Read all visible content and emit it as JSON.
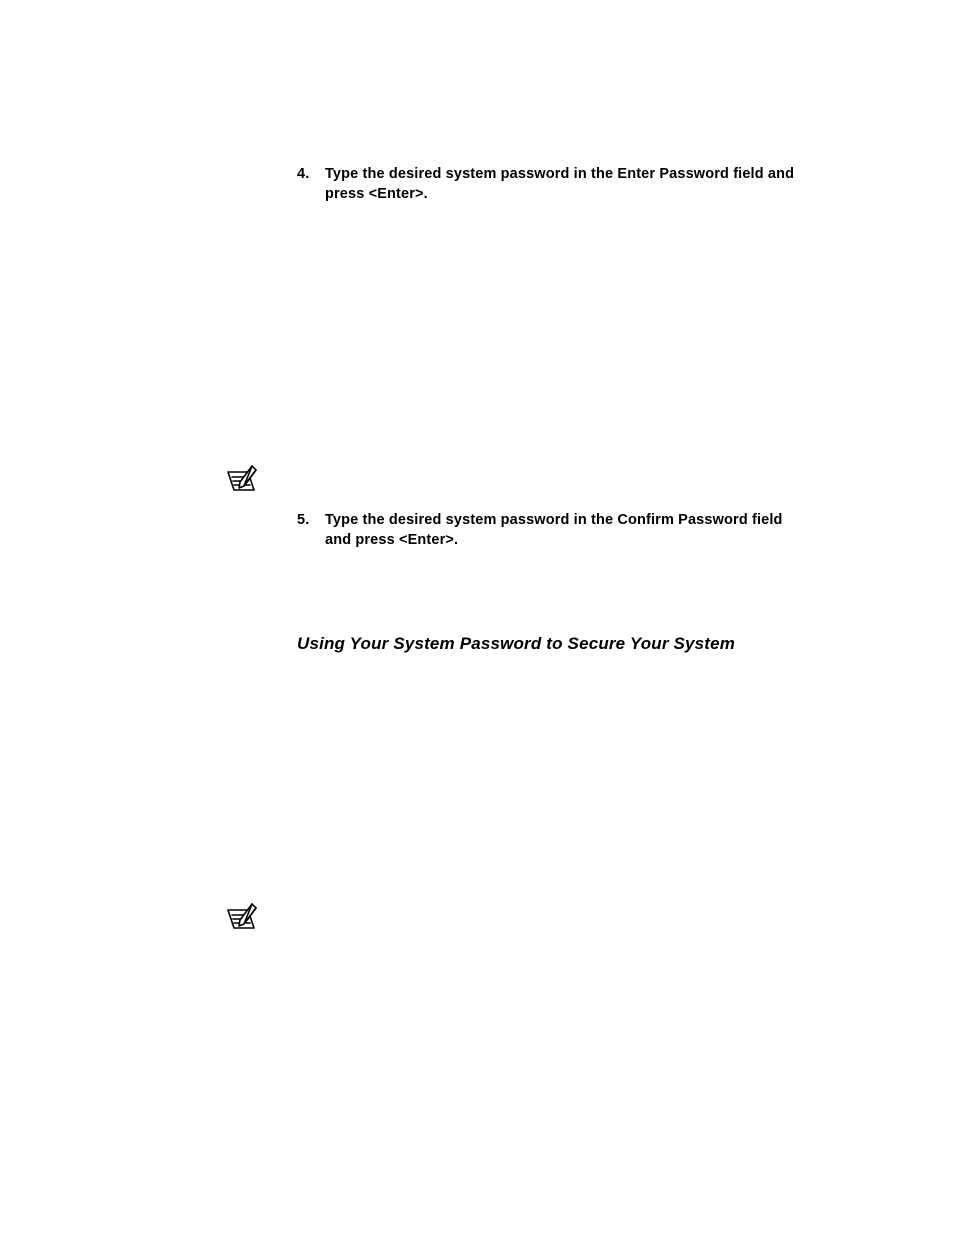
{
  "steps": {
    "s4": {
      "number": "4.",
      "text": "Type the desired system password in the Enter Password field and press <Enter>."
    },
    "s5": {
      "number": "5.",
      "text": "Type the desired system password in the Confirm Password field and press <Enter>."
    }
  },
  "heading": "Using Your System Password to Secure Your System"
}
